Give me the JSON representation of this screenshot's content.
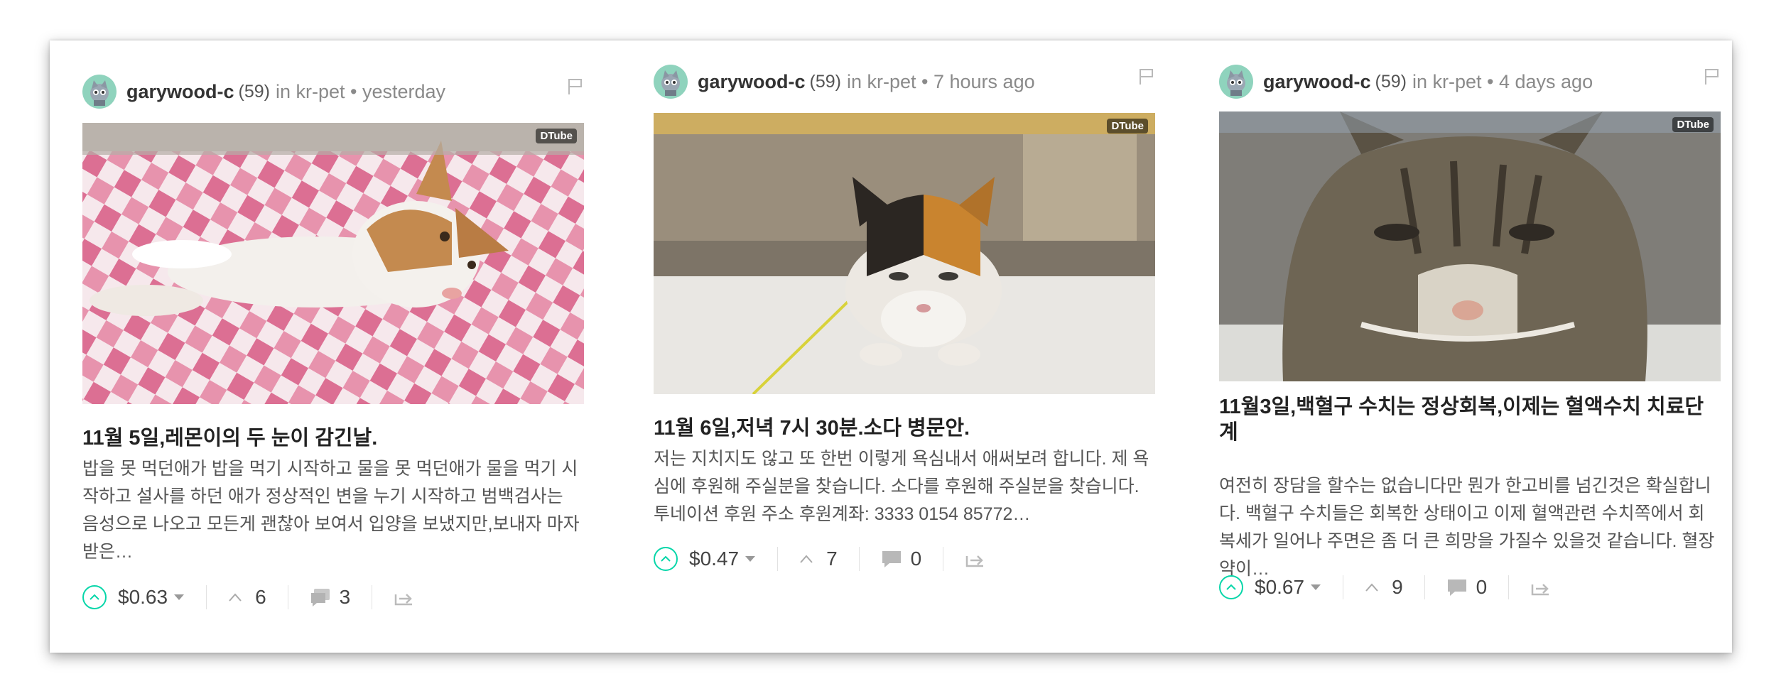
{
  "cards": [
    {
      "author": "garywood-c",
      "reputation": "(59)",
      "meta": "in kr-pet • yesterday",
      "title": "11월 5일,레몬이의 두 눈이 감긴날.",
      "excerpt": "밥을 못 먹던애가 밥을 먹기 시작하고 물을 못 먹던애가 물을 먹기 시작하고 설사를 하던 애가 정상적인 변을 누기 시작하고 범백검사는 음성으로 나오고 모든게 괜찮아 보여서 입양을 보냈지만,보내자 마자 받은…",
      "payout": "$0.63",
      "votes": "6",
      "comments": "3",
      "badge": "DTube"
    },
    {
      "author": "garywood-c",
      "reputation": "(59)",
      "meta": "in kr-pet • 7 hours ago",
      "title": "11월 6일,저녁 7시 30분.소다 병문안.",
      "excerpt": "저는 지치지도 않고 또 한번 이렇게 욕심내서 애써보려 합니다. 제 욕심에 후원해 주실분을 찾습니다. 소다를 후원해 주실분을 찾습니다. 투네이션 후원 주소 후원계좌: 3333 0154 85772…",
      "payout": "$0.47",
      "votes": "7",
      "comments": "0",
      "badge": "DTube"
    },
    {
      "author": "garywood-c",
      "reputation": "(59)",
      "meta": "in kr-pet • 4 days ago",
      "title": "11월3일,백혈구 수치는 정상회복,이제는 혈액수치 치료단계",
      "excerpt": "여전히 장담을 할수는 없습니다만 뭔가 한고비를 넘긴것은 확실합니다. 백혈구 수치들은 회복한 상태이고 이제 혈액관련 수치쪽에서 회복세가 일어나 주면은 좀 더 큰 희망을 가질수 있을것 같습니다. 혈장약이…",
      "payout": "$0.67",
      "votes": "9",
      "comments": "0",
      "badge": "DTube"
    }
  ],
  "colors": {
    "accent": "#06d6a9",
    "meta": "#8a8a8a",
    "title": "#222222"
  },
  "icons": [
    "avatar",
    "flag-icon",
    "upvote-circle-icon",
    "caret-down-icon",
    "upvote-chevron-icon",
    "comment-icon",
    "resteem-icon"
  ]
}
